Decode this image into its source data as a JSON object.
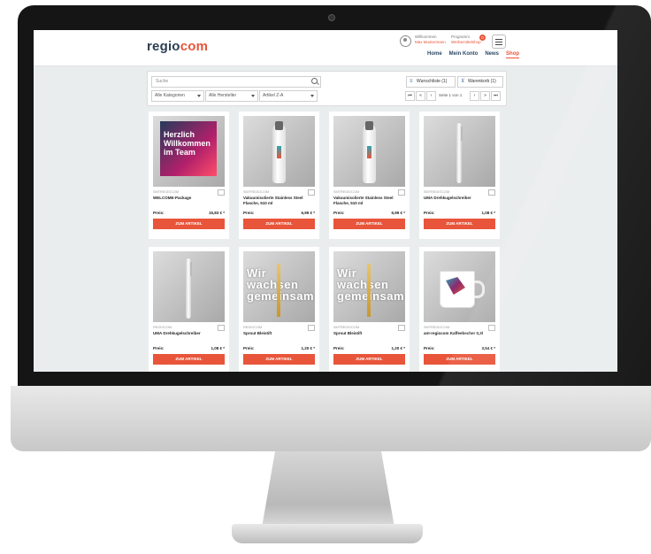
{
  "brand": {
    "logo_part1": "regio",
    "logo_part2": "com",
    "accent": "#e8553a",
    "navy": "#2c4a66"
  },
  "user": {
    "greeting": "Willkommen",
    "name": "Max Mustermann",
    "program_label": "Programm",
    "program_name": "Werbemittelshop",
    "notification_count": "0"
  },
  "nav": {
    "items": [
      "Home",
      "Mein Konto",
      "News",
      "Shop"
    ],
    "active": "Shop"
  },
  "filters": {
    "search_placeholder": "Suche",
    "category": "Alle Kategorien",
    "manufacturer": "Alle Hersteller",
    "sort": "Artikel Z-A",
    "wishlist_label": "Wunschliste (1)",
    "cart_label": "Warenkorb (1)",
    "page_text": "Seite 1 von 1"
  },
  "products": [
    {
      "supplier": "SMTREGIOCOM",
      "name": "WELCOME-Package",
      "price_label": "Preis:",
      "price": "15,83 € *",
      "cta": "ZUM ARTIKEL",
      "image": "welcome-box",
      "image_text": [
        "Herzlich",
        "Willkommen",
        "im Team"
      ]
    },
    {
      "supplier": "SMTREGIOCOM",
      "name": "Vakuumisolierte Stainless Steel Flasche, 510 ml",
      "price_label": "Preis:",
      "price": "6,99 € *",
      "cta": "ZUM ARTIKEL",
      "image": "bottle"
    },
    {
      "supplier": "SMTREGIOCOM",
      "name": "Vakuumisolierte Stainless Steel Flasche, 510 ml",
      "price_label": "Preis:",
      "price": "6,99 € *",
      "cta": "ZUM ARTIKEL",
      "image": "bottle"
    },
    {
      "supplier": "SMTREGIOCOM",
      "name": "UMA Drehkugelschreiber",
      "price_label": "Preis:",
      "price": "1,08 € *",
      "cta": "ZUM ARTIKEL",
      "image": "pen"
    },
    {
      "supplier": "REGIOCOM",
      "name": "UMA Drehkugelschreiber",
      "price_label": "Preis:",
      "price": "1,08 € *",
      "cta": "ZUM ARTIKEL",
      "image": "pen"
    },
    {
      "supplier": "REGIOCOM",
      "name": "Sprout Bleistift",
      "price_label": "Preis:",
      "price": "1,20 € *",
      "cta": "ZUM ARTIKEL",
      "image": "pencil-wall",
      "image_text": [
        "Wir wachsen",
        "gemeinsam"
      ]
    },
    {
      "supplier": "SMTREGIOCOM",
      "name": "Sprout Bleistift",
      "price_label": "Preis:",
      "price": "1,20 € *",
      "cta": "ZUM ARTIKEL",
      "image": "pencil-wall",
      "image_text": [
        "Wir wachsen",
        "gemeinsam"
      ]
    },
    {
      "supplier": "SMTREGIOCOM",
      "name": "ant-regiocom Kaffeebecher 0,3l",
      "price_label": "Preis:",
      "price": "3,54 € *",
      "cta": "ZUM ARTIKEL",
      "image": "mug"
    }
  ]
}
